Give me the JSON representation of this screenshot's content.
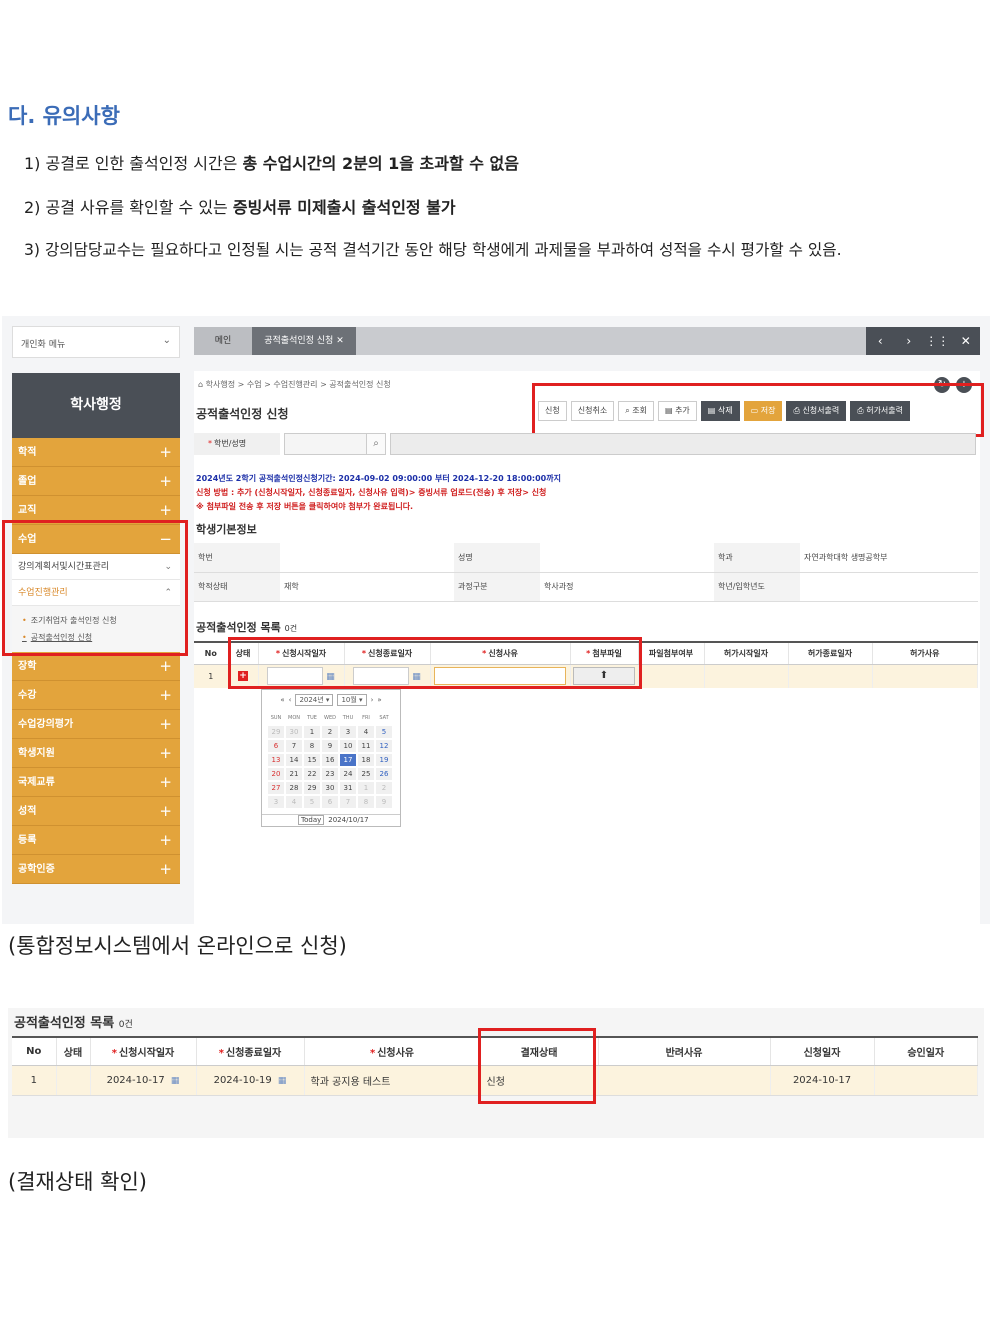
{
  "heading": "다. 유의사항",
  "notes": [
    {
      "pre": "1) 공결로 인한 출석인정 시간은 ",
      "bold": "총 수업시간의 2분의 1을 초과할 수 없음",
      "post": ""
    },
    {
      "pre": "2) 공결 사유를 확인할 수 있는 ",
      "bold": "증빙서류 미제출시 출석인정 불가",
      "post": ""
    },
    {
      "pre": "3) 강의담당교수는 필요하다고 인정될 시는 공적 결석기간 동안 해당 학생에게 과제물을 부과하여 성적을 수시 평가할 수 있음.",
      "bold": "",
      "post": ""
    }
  ],
  "caption1": "(통합정보시스템에서 온라인으로 신청)",
  "caption2": "(결재상태 확인)",
  "colors": {
    "accent": "#3b6cb7",
    "sidebar_orange": "#e3a43c",
    "highlight": "#e02020",
    "dark": "#4a4f56"
  },
  "shot1": {
    "personal_menu": "개인화 메뉴",
    "sidebar_title": "학사행정",
    "sidebar_top": [
      {
        "label": "학적",
        "sign": "+"
      },
      {
        "label": "졸업",
        "sign": "+"
      },
      {
        "label": "교직",
        "sign": "+"
      },
      {
        "label": "수업",
        "sign": "−"
      }
    ],
    "sub_plan": "강의계획서및시간표관리",
    "sub_progress": "수업진행관리",
    "leaf_early": "조기취업자 출석인정 신청",
    "leaf_official": "공적출석인정 신청",
    "sidebar_bottom": [
      {
        "label": "장학",
        "sign": "+"
      },
      {
        "label": "수강",
        "sign": "+"
      },
      {
        "label": "수업강의평가",
        "sign": "+"
      },
      {
        "label": "학생지원",
        "sign": "+"
      },
      {
        "label": "국제교류",
        "sign": "+"
      },
      {
        "label": "성적",
        "sign": "+"
      },
      {
        "label": "등록",
        "sign": "+"
      },
      {
        "label": "공학인증",
        "sign": "+"
      }
    ],
    "tab_main": "메인",
    "tab_active": "공적출석인정 신청 ✕",
    "breadcrumb": "학사행정 > 수업 > 수업진행관리 > 공적출석인정 신청",
    "page_title": "공적출석인정 신청",
    "toolbar": {
      "apply": "신청",
      "cancel": "신청취소",
      "search": "조회",
      "add": "추가",
      "delete": "삭제",
      "save": "저장",
      "print_apply": "신청서출력",
      "print_permit": "허가서출력"
    },
    "search_label": "학번/성명",
    "period_line": "2024년도 2학기 공적출석인정신청기간: 2024-09-02 09:00:00 부터 2024-12-20 18:00:00까지",
    "method_line": "신청 방법 : 추가 (신청시작일자, 신청종료일자, 신청사유 입력)> 증빙서류 업로드(전송) 후 저장> 신청",
    "attach_line": "※ 첨부파일 전송 후 저장 버튼을 클릭하여야 첨부가 완료됩니다.",
    "basic_title": "학생기본정보",
    "basic": {
      "l_id": "학번",
      "l_name": "성명",
      "l_dept": "학과",
      "v_dept": "자연과학대학 생명공학부",
      "l_status": "학적상태",
      "v_status": "재학",
      "l_course": "과정구분",
      "v_course": "학사과정",
      "l_year": "학년/입학년도"
    },
    "list_title": "공적출석인정 목록",
    "list_count": "0건",
    "cols": {
      "no": "No",
      "state": "상태",
      "start": "신청시작일자",
      "end": "신청종료일자",
      "reason": "신청사유",
      "attach": "첨부파일",
      "attach_yn": "파일첨부여부",
      "pstart": "허가시작일자",
      "pend": "허가종료일자",
      "preason": "허가사유"
    },
    "row_no": "1",
    "calendar": {
      "year": "2024년",
      "month": "10월",
      "dow": [
        "SUN",
        "MON",
        "TUE",
        "WED",
        "THU",
        "FRI",
        "SAT"
      ],
      "days": [
        "29",
        "30",
        "1",
        "2",
        "3",
        "4",
        "5",
        "6",
        "7",
        "8",
        "9",
        "10",
        "11",
        "12",
        "13",
        "14",
        "15",
        "16",
        "17",
        "18",
        "19",
        "20",
        "21",
        "22",
        "23",
        "24",
        "25",
        "26",
        "27",
        "28",
        "29",
        "30",
        "31",
        "1",
        "2",
        "3",
        "4",
        "5",
        "6",
        "7",
        "8",
        "9"
      ],
      "today_label": "Today",
      "today_date": "2024/10/17"
    }
  },
  "shot2": {
    "title": "공적출석인정 목록",
    "count": "0건",
    "cols": {
      "no": "No",
      "state": "상태",
      "start": "신청시작일자",
      "end": "신청종료일자",
      "reason": "신청사유",
      "approval": "결재상태",
      "reject": "반려사유",
      "applied": "신청일자",
      "approved": "승인일자"
    },
    "row": {
      "no": "1",
      "start": "2024-10-17",
      "end": "2024-10-19",
      "reason": "학과 공지용 테스트",
      "approval": "신청",
      "applied": "2024-10-17"
    }
  }
}
